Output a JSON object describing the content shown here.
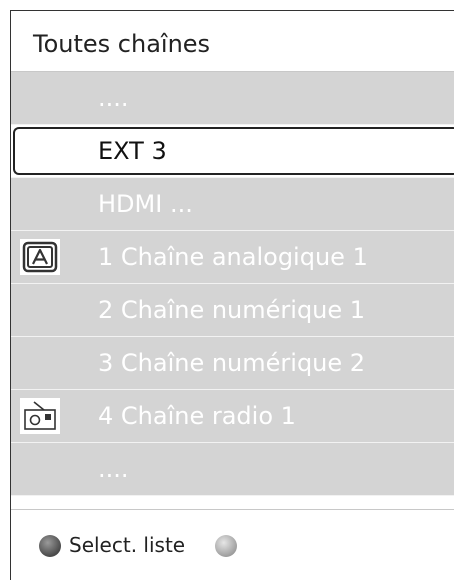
{
  "header": {
    "title": "Toutes chaînes"
  },
  "list": {
    "rows": [
      {
        "label": "....",
        "icon": ""
      },
      {
        "label": "EXT 3",
        "icon": "",
        "selected": true
      },
      {
        "label": "HDMI ...",
        "icon": ""
      },
      {
        "label": "1 Chaîne analogique 1",
        "icon": "analog-a-icon"
      },
      {
        "label": "2 Chaîne numérique 1",
        "icon": ""
      },
      {
        "label": "3 Chaîne numérique 2",
        "icon": ""
      },
      {
        "label": "4 Chaîne radio 1",
        "icon": "radio-icon"
      },
      {
        "label": "....",
        "icon": ""
      }
    ]
  },
  "footer": {
    "select_label": "Select. liste"
  }
}
